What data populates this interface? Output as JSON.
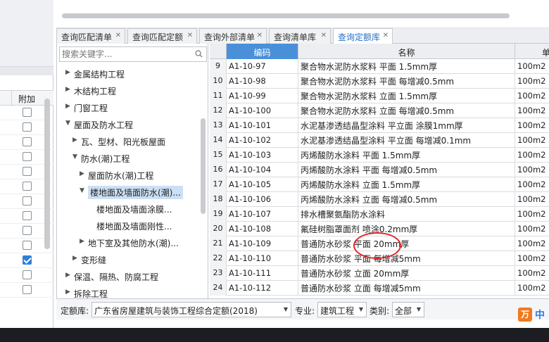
{
  "tabs": [
    {
      "label": "查询匹配清单",
      "active": false
    },
    {
      "label": "查询匹配定额",
      "active": false
    },
    {
      "label": "查询外部清单",
      "active": false
    },
    {
      "label": "查询清单库",
      "active": false
    },
    {
      "label": "查询定额库",
      "active": true
    }
  ],
  "left_panel": {
    "header_label": "附加",
    "checkboxes": [
      false,
      false,
      false,
      false,
      false,
      false,
      false,
      false,
      false,
      false,
      true,
      false,
      false
    ]
  },
  "search": {
    "placeholder": "搜索关键字..."
  },
  "tree": [
    {
      "label": "金属结构工程",
      "arrow": "▶"
    },
    {
      "label": "木结构工程",
      "arrow": "▶"
    },
    {
      "label": "门窗工程",
      "arrow": "▶"
    },
    {
      "label": "屋面及防水工程",
      "arrow": "▼"
    },
    {
      "label": "瓦、型材、阳光板屋面",
      "arrow": "▶"
    },
    {
      "label": "防水(潮)工程",
      "arrow": "▼"
    },
    {
      "label": "屋面防水(潮)工程",
      "arrow": "▶"
    },
    {
      "label": "楼地面及墙面防水(潮)...",
      "arrow": "▼"
    },
    {
      "label": "楼地面及墙面涂膜...",
      "arrow": ""
    },
    {
      "label": "楼地面及墙面刚性...",
      "arrow": ""
    },
    {
      "label": "地下室及其他防水(潮)...",
      "arrow": "▶"
    },
    {
      "label": "变形缝",
      "arrow": "▶"
    },
    {
      "label": "保温、隔热、防腐工程",
      "arrow": "▶"
    },
    {
      "label": "拆除工程",
      "arrow": "▶"
    }
  ],
  "grid": {
    "columns": {
      "code": "编码",
      "name": "名称",
      "unit": "单"
    },
    "rows": [
      {
        "num": "9",
        "code": "A1-10-97",
        "name": "聚合物水泥防水浆料 平面 1.5mm厚",
        "unit": "100m2"
      },
      {
        "num": "10",
        "code": "A1-10-98",
        "name": "聚合物水泥防水浆料 平面 每增减0.5mm",
        "unit": "100m2"
      },
      {
        "num": "11",
        "code": "A1-10-99",
        "name": "聚合物水泥防水浆料 立面 1.5mm厚",
        "unit": "100m2"
      },
      {
        "num": "12",
        "code": "A1-10-100",
        "name": "聚合物水泥防水浆料 立面 每增减0.5mm",
        "unit": "100m2"
      },
      {
        "num": "13",
        "code": "A1-10-101",
        "name": "水泥基渗透结晶型涂料 平立面 涂膜1mm厚",
        "unit": "100m2"
      },
      {
        "num": "14",
        "code": "A1-10-102",
        "name": "水泥基渗透结晶型涂料 平立面 每增减0.1mm",
        "unit": "100m2"
      },
      {
        "num": "15",
        "code": "A1-10-103",
        "name": "丙烯酸防水涂料 平面 1.5mm厚",
        "unit": "100m2"
      },
      {
        "num": "16",
        "code": "A1-10-104",
        "name": "丙烯酸防水涂料 平面 每增减0.5mm",
        "unit": "100m2"
      },
      {
        "num": "17",
        "code": "A1-10-105",
        "name": "丙烯酸防水涂料 立面 1.5mm厚",
        "unit": "100m2"
      },
      {
        "num": "18",
        "code": "A1-10-106",
        "name": "丙烯酸防水涂料 立面 每增减0.5mm",
        "unit": "100m2"
      },
      {
        "num": "19",
        "code": "A1-10-107",
        "name": "排水槽聚氨酯防水涂料",
        "unit": "100m2"
      },
      {
        "num": "20",
        "code": "A1-10-108",
        "name": "氟硅树脂罩面剂 喷涂0.2mm厚",
        "unit": "100m2"
      },
      {
        "num": "21",
        "code": "A1-10-109",
        "name": "普通防水砂浆 平面 20mm厚",
        "unit": "100m2"
      },
      {
        "num": "22",
        "code": "A1-10-110",
        "name": "普通防水砂浆 平面 每增减5mm",
        "unit": "100m2"
      },
      {
        "num": "23",
        "code": "A1-10-111",
        "name": "普通防水砂浆 立面 20mm厚",
        "unit": "100m2"
      },
      {
        "num": "24",
        "code": "A1-10-112",
        "name": "普通防水砂浆 立面 每增减5mm",
        "unit": "100m2"
      }
    ]
  },
  "bottom_bar": {
    "quota_label": "定额库:",
    "quota_value": "广东省房屋建筑与装饰工程综合定额(2018)",
    "major_label": "专业:",
    "major_value": "建筑工程",
    "category_label": "类别:",
    "category_value": "全部"
  },
  "logo": {
    "badge": "万",
    "text": "中"
  },
  "colors": {
    "accent": "#4a90d9",
    "annotation": "#e0262a",
    "logo": "#f07a1e"
  }
}
